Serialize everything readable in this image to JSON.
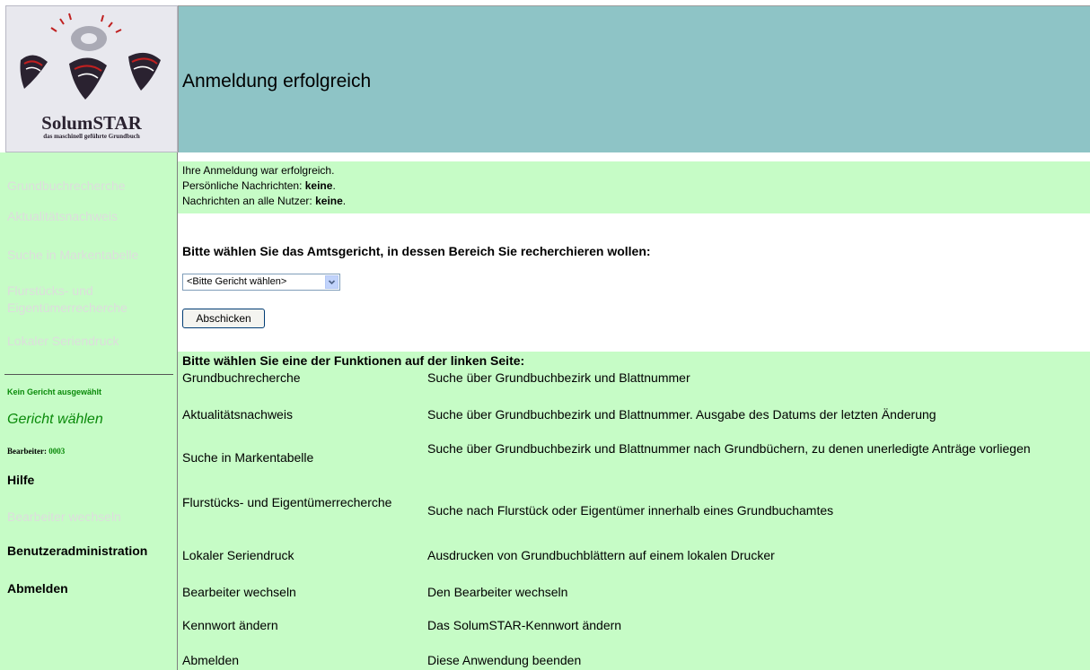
{
  "logo": {
    "name": "SolumSTAR",
    "subtitle": "das maschinell geführte Grundbuch"
  },
  "header": {
    "title": "Anmeldung erfolgreich"
  },
  "sidebar": {
    "functions": [
      "Grundbuchrecherche",
      "Aktualitätsnachweis",
      "Suche in Markentabelle",
      "Flurstücks- und",
      "Eigentümerrecherche",
      "Lokaler Seriendruck"
    ],
    "no_court": "Kein Gericht ausgewählt",
    "select_court": "Gericht wählen",
    "editor_label": "Bearbeiter:",
    "editor_value": "0003",
    "help": "Hilfe",
    "change_editor": "Bearbeiter wechseln",
    "user_admin": "Benutzeradministration",
    "logout": "Abmelden"
  },
  "messages": {
    "line1": "Ihre Anmeldung war erfolgreich.",
    "line2_label": "Persönliche Nachrichten:",
    "line2_value": "keine",
    "line3_label": "Nachrichten an alle Nutzer:",
    "line3_value": "keine"
  },
  "court": {
    "question": "Bitte wählen Sie das Amtsgericht, in dessen Bereich Sie recherchieren wollen:",
    "dropdown_value": "<Bitte Gericht wählen>",
    "submit_label": "Abschicken"
  },
  "functions": {
    "heading": "Bitte wählen Sie eine der Funktionen auf der linken Seite:",
    "rows": [
      {
        "name": "Grundbuchrecherche",
        "desc": "Suche über Grundbuchbezirk und Blattnummer"
      },
      {
        "name": "Aktualitätsnachweis",
        "desc": "Suche über Grundbuchbezirk und Blattnummer. Ausgabe des Datums der letzten Änderung"
      },
      {
        "name": "Suche in Markentabelle",
        "desc": "Suche über Grundbuchbezirk und Blattnummer nach Grundbüchern, zu denen unerledigte Anträge vorliegen"
      },
      {
        "name": "Flurstücks- und Eigentümerrecherche",
        "desc": "Suche nach Flurstück oder Eigentümer innerhalb eines Grundbuchamtes"
      },
      {
        "name": "Lokaler Seriendruck",
        "desc": "Ausdrucken von Grundbuchblättern auf einem lokalen Drucker"
      },
      {
        "name": "Bearbeiter wechseln",
        "desc": "Den Bearbeiter wechseln"
      },
      {
        "name": "Kennwort ändern",
        "desc": "Das SolumSTAR-Kennwort ändern"
      },
      {
        "name": "Abmelden",
        "desc": "Diese Anwendung beenden"
      }
    ]
  },
  "colors": {
    "header_bg": "#8ec4c6",
    "panel_bg": "#c6fcc6",
    "accent_green": "#0a8a0a",
    "disabled_text": "#dddddd"
  }
}
